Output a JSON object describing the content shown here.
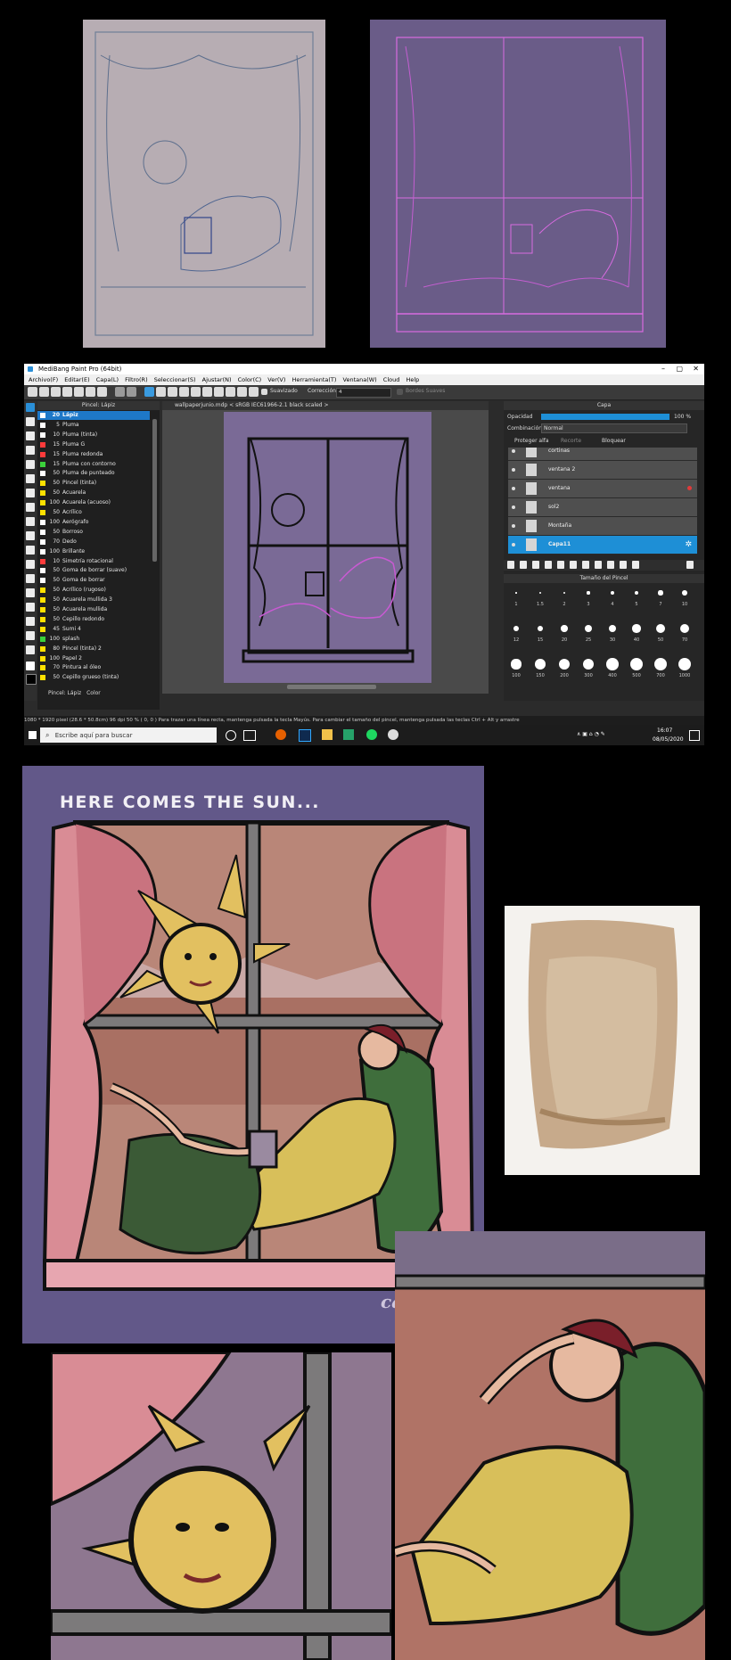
{
  "app": {
    "title": "MediBang Paint Pro (64bit)",
    "window_controls": [
      "–",
      "▢",
      "✕"
    ],
    "menu": [
      "Archivo(F)",
      "Editar(E)",
      "Capa(L)",
      "Filtro(R)",
      "Seleccionar(S)",
      "Ajustar(N)",
      "Color(C)",
      "Ver(V)",
      "Herramienta(T)",
      "Ventana(W)",
      "Cloud",
      "Help"
    ],
    "toolbar": {
      "smoothing_label": "Suavizado",
      "correction_label": "Corrección",
      "correction_value": "4",
      "soft_edges_label": "Bordes Suaves"
    },
    "brush_panel": {
      "title": "Pincel: Lápiz",
      "brushes": [
        {
          "size": "20",
          "name": "Lápiz",
          "color": "#ffffff",
          "selected": true
        },
        {
          "size": "5",
          "name": "Pluma",
          "color": "#ffffff"
        },
        {
          "size": "10",
          "name": "Pluma (tinta)",
          "color": "#ffffff"
        },
        {
          "size": "15",
          "name": "Pluma G",
          "color": "#ff3b3b"
        },
        {
          "size": "15",
          "name": "Pluma redonda",
          "color": "#ff3b3b"
        },
        {
          "size": "15",
          "name": "Pluma con contorno",
          "color": "#3bd13b"
        },
        {
          "size": "50",
          "name": "Pluma de punteado",
          "color": "#ffffff"
        },
        {
          "size": "50",
          "name": "Pincel (tinta)",
          "color": "#ffe100"
        },
        {
          "size": "50",
          "name": "Acuarela",
          "color": "#ffe100"
        },
        {
          "size": "100",
          "name": "Acuarela (acuoso)",
          "color": "#ffe100"
        },
        {
          "size": "50",
          "name": "Acrílico",
          "color": "#ffe100"
        },
        {
          "size": "100",
          "name": "Aerógrafo",
          "color": "#ffffff"
        },
        {
          "size": "50",
          "name": "Borroso",
          "color": "#ffffff"
        },
        {
          "size": "70",
          "name": "Dedo",
          "color": "#ffffff"
        },
        {
          "size": "100",
          "name": "Brillante",
          "color": "#ffffff"
        },
        {
          "size": "10",
          "name": "Simetría rotacional",
          "color": "#ff3b3b"
        },
        {
          "size": "50",
          "name": "Goma de borrar (suave)",
          "color": "#ffffff"
        },
        {
          "size": "50",
          "name": "Goma de borrar",
          "color": "#ffffff"
        },
        {
          "size": "50",
          "name": "Acrílico (rugoso)",
          "color": "#ffe100"
        },
        {
          "size": "50",
          "name": "Acuarela mullida 3",
          "color": "#ffe100"
        },
        {
          "size": "50",
          "name": "Acuarela mullida",
          "color": "#ffe100"
        },
        {
          "size": "50",
          "name": "Cepillo redondo",
          "color": "#ffe100"
        },
        {
          "size": "45",
          "name": "Sumi 4",
          "color": "#ffe100"
        },
        {
          "size": "100",
          "name": "splash",
          "color": "#3bd13b"
        },
        {
          "size": "80",
          "name": "Pincel (tinta) 2",
          "color": "#ffe100"
        },
        {
          "size": "100",
          "name": "Papel 2",
          "color": "#ffe100"
        },
        {
          "size": "70",
          "name": "Pintura al óleo",
          "color": "#ffe100"
        },
        {
          "size": "50",
          "name": "Cepillo grueso (tinta)",
          "color": "#ffe100"
        }
      ],
      "tabs": [
        "Pincel: Lápiz",
        "Color"
      ]
    },
    "canvas_tab": "wallpaperjunio.mdp  < sRGB IEC61966-2.1 black scaled >",
    "layer_panel": {
      "title": "Capa",
      "opacity_label": "Opacidad",
      "opacity_value": "100 %",
      "blend_label": "Combinación",
      "blend_value": "Normal",
      "protect_alpha": "Proteger alfa",
      "clip": "Recorte",
      "lock": "Bloquear",
      "layers": [
        {
          "name": "cortinas"
        },
        {
          "name": "ventana 2"
        },
        {
          "name": "ventana"
        },
        {
          "name": "sol2"
        },
        {
          "name": "Montaña"
        },
        {
          "name": "Capa11",
          "selected": true
        }
      ]
    },
    "brush_size_panel": {
      "title": "Tamaño del Pincel",
      "sizes": [
        "1",
        "1.5",
        "2",
        "3",
        "4",
        "5",
        "7",
        "10",
        "12",
        "15",
        "20",
        "25",
        "30",
        "40",
        "50",
        "70",
        "100",
        "150",
        "200",
        "300",
        "400",
        "500",
        "700",
        "1000"
      ]
    },
    "status_bar": "1080 * 1920 pixel   (28.6 * 50.8cm)   96 dpi   50 %   ( 0, 0 )   Para trazar una línea recta, mantenga pulsada la tecla Mayús. Para cambiar el tamaño del pincel, mantenga pulsada las teclas Ctrl + Alt y arrastre",
    "taskbar": {
      "search_placeholder": "Escribe aquí para buscar",
      "time": "16:07",
      "date": "08/05/2020"
    }
  },
  "artwork": {
    "title": "HERE COMES THE SUN...",
    "signature": "caged."
  },
  "colors": {
    "art_background": "#625889",
    "curtain": "#d98c95",
    "sun": "#e2c060",
    "ui_accent": "#1e8fd6"
  }
}
